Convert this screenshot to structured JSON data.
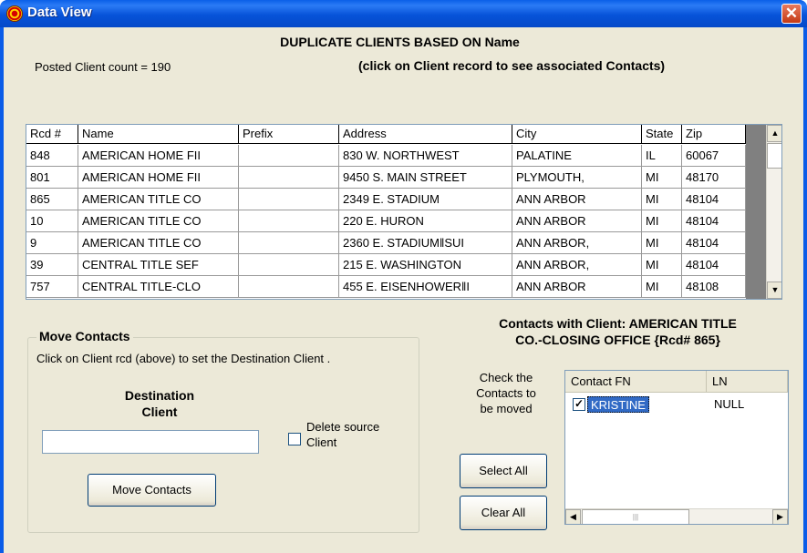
{
  "window": {
    "title": "Data View",
    "close_glyph": "✕"
  },
  "header": {
    "heading": "DUPLICATE CLIENTS BASED ON Name",
    "posted_count": "Posted Client count = 190",
    "click_hint": "(click on Client record to see associated Contacts)"
  },
  "client_grid": {
    "columns": [
      "Rcd #",
      "Name",
      "Prefix",
      "Address",
      "City",
      "State",
      "Zip"
    ],
    "rows": [
      [
        "848",
        "AMERICAN HOME FII",
        "",
        "830 W. NORTHWEST",
        "PALATINE",
        "IL",
        "60067"
      ],
      [
        "801",
        "AMERICAN HOME FII",
        "",
        "9450 S. MAIN STREET",
        "PLYMOUTH,",
        "MI",
        "48170"
      ],
      [
        "865",
        "AMERICAN TITLE CO",
        "",
        "2349 E. STADIUM",
        "ANN ARBOR",
        "MI",
        "48104"
      ],
      [
        "10",
        "AMERICAN TITLE CO",
        "",
        "220 E. HURON",
        "ANN ARBOR",
        "MI",
        "48104"
      ],
      [
        "9",
        "AMERICAN TITLE CO",
        "",
        "2360 E. STADIUM‖SUI",
        "ANN ARBOR,",
        "MI",
        "48104"
      ],
      [
        "39",
        "CENTRAL TITLE SEF",
        "",
        "215 E. WASHINGTON",
        "ANN ARBOR,",
        "MI",
        "48104"
      ],
      [
        "757",
        "CENTRAL TITLE-CLO",
        "",
        "455 E. EISENHOWER‖I",
        "ANN ARBOR",
        "MI",
        "48108"
      ]
    ],
    "scroll_up_glyph": "▲",
    "scroll_down_glyph": "▼"
  },
  "move_contacts": {
    "legend": "Move Contacts",
    "hint": "Click on Client rcd (above) to set the Destination Client .",
    "destination_label_line1": "Destination",
    "destination_label_line2": "Client",
    "destination_value": "",
    "delete_source_label_line1": "Delete source",
    "delete_source_label_line2": "Client",
    "delete_source_checked": false,
    "move_button": "Move Contacts"
  },
  "contacts": {
    "title_line1": "Contacts with Client: AMERICAN TITLE",
    "title_line2": "CO.-CLOSING OFFICE {Rcd# 865}",
    "check_hint_line1": "Check the",
    "check_hint_line2": "Contacts to",
    "check_hint_line3": "be moved",
    "select_all": "Select All",
    "clear_all": "Clear All",
    "columns": [
      "Contact FN",
      "LN"
    ],
    "rows": [
      {
        "checked": true,
        "check_glyph": "✓",
        "fn": "KRISTINE",
        "ln": "NULL"
      }
    ],
    "scroll_left_glyph": "◀",
    "scroll_right_glyph": "▶",
    "thumb_grip": "|||"
  },
  "colors": {
    "titlebar": "#0a5ce8",
    "face": "#ece9d8",
    "selection": "#316ac5",
    "close": "#c43a15"
  }
}
